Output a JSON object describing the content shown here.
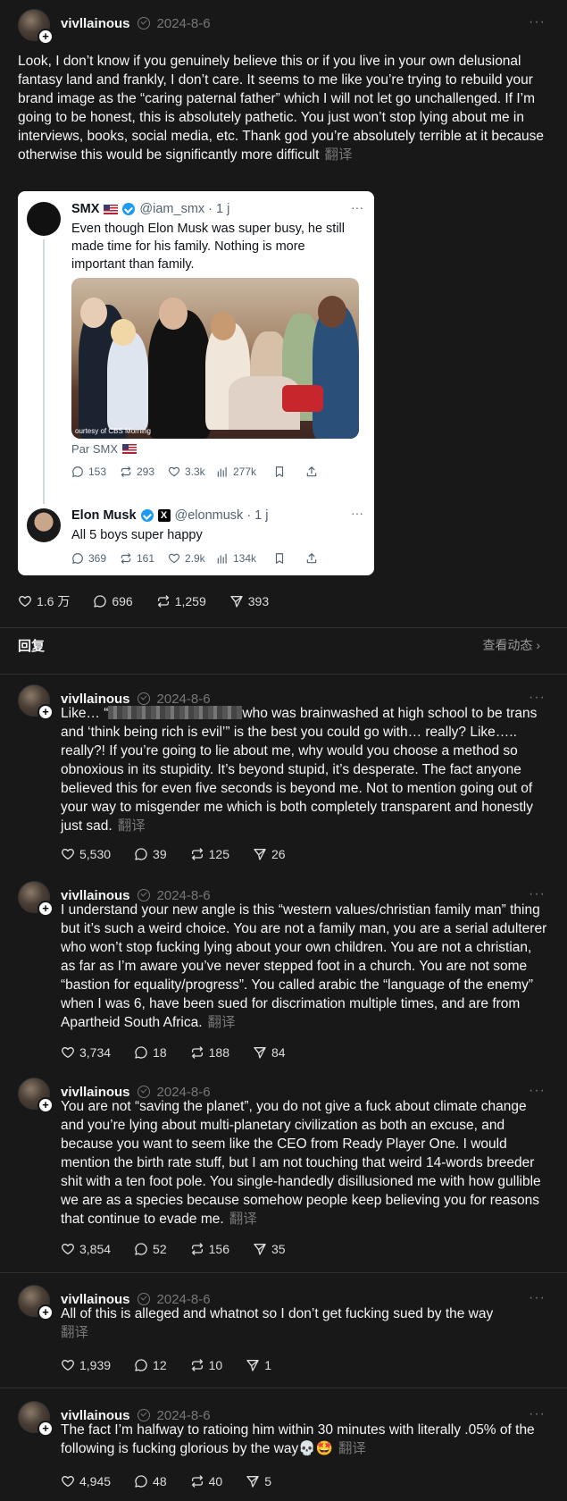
{
  "main_post": {
    "username": "vivllainous",
    "date": "2024-8-6",
    "more": "···",
    "text": "Look, I don’t know if you genuinely believe this or if you live in your own delusional fantasy land and frankly, I don’t care. It seems to me like you’re trying to rebuild your brand image as the “caring paternal father” which I will not let go unchallenged. If I’m going to be honest, this is absolutely pathetic. You just won’t stop lying about me in interviews, books, social media, etc. Thank god you’re absolutely terrible at it because otherwise this would be significantly more difficult",
    "translate": "翻译",
    "likes": "1.6 万",
    "comments": "696",
    "reposts": "1,259",
    "shares": "393"
  },
  "embed": {
    "tweet1": {
      "name": "SMX",
      "handle": "@iam_smx · 1 j",
      "text": "Even though Elon Musk was super busy, he still made time for his family. Nothing is more important than family.",
      "photo_credit": "ourtesy of CBS Morning",
      "par": "Par SMX",
      "replies": "153",
      "retweets": "293",
      "likes": "3.3k",
      "views": "277k"
    },
    "tweet2": {
      "name": "Elon Musk",
      "handle": "@elonmusk · 1 j",
      "text": "All 5 boys super happy",
      "replies": "369",
      "retweets": "161",
      "likes": "2.9k",
      "views": "134k"
    }
  },
  "reply_bar": {
    "label": "回复",
    "activity": "查看动态 ›"
  },
  "replies": [
    {
      "username": "vivllainous",
      "date": "2024-8-6",
      "text_pre": "Like… “",
      "text_post": "who was brainwashed at high school to be trans and ‘think being rich is evil’” is the best you could go with… really? Like….. really?! If you’re going to lie about me, why would you choose a method so obnoxious in its stupidity. It’s beyond stupid, it’s desperate. The fact anyone believed this for even five seconds is beyond me. Not to mention going out of your way to misgender me which is both completely transparent and honestly just sad.",
      "translate": "翻译",
      "likes": "5,530",
      "comments": "39",
      "reposts": "125",
      "shares": "26"
    },
    {
      "username": "vivllainous",
      "date": "2024-8-6",
      "text": "I understand your new angle is this “western values/christian family man” thing but it’s such a weird choice. You are not a family man, you are a serial adulterer who won’t stop fucking lying about your own children. You are not a christian, as far as I’m aware you’ve never stepped foot in a church. You are not some “bastion for equality/progress”. You called arabic the “language of the enemy” when I was 6, have been sued for discrimation multiple times, and are from Apartheid South Africa.",
      "translate": "翻译",
      "likes": "3,734",
      "comments": "18",
      "reposts": "188",
      "shares": "84"
    },
    {
      "username": "vivllainous",
      "date": "2024-8-6",
      "text": "You are not “saving the planet”, you do not give a fuck about climate change and you’re lying about multi-planetary civilization as both an excuse, and because you want to seem like the CEO from Ready Player One. I would mention the birth rate stuff, but I am not touching that weird 14-words breeder shit with a ten foot pole. You single-handedly disillusioned me with how gullible we are as a species because somehow people keep believing you for reasons that continue to evade me.",
      "translate": "翻译",
      "likes": "3,854",
      "comments": "52",
      "reposts": "156",
      "shares": "35"
    },
    {
      "username": "vivllainous",
      "date": "2024-8-6",
      "text": "All of this is alleged and whatnot so I don’t get fucking sued by the way",
      "translate": "翻译",
      "likes": "1,939",
      "comments": "12",
      "reposts": "10",
      "shares": "1"
    },
    {
      "username": "vivllainous",
      "date": "2024-8-6",
      "text": "The fact I’m halfway to ratioing him within 30 minutes with literally .05% of the following is fucking glorious by the way💀🤩",
      "translate": "翻译",
      "likes": "4,945",
      "comments": "48",
      "reposts": "40",
      "shares": "5"
    }
  ]
}
